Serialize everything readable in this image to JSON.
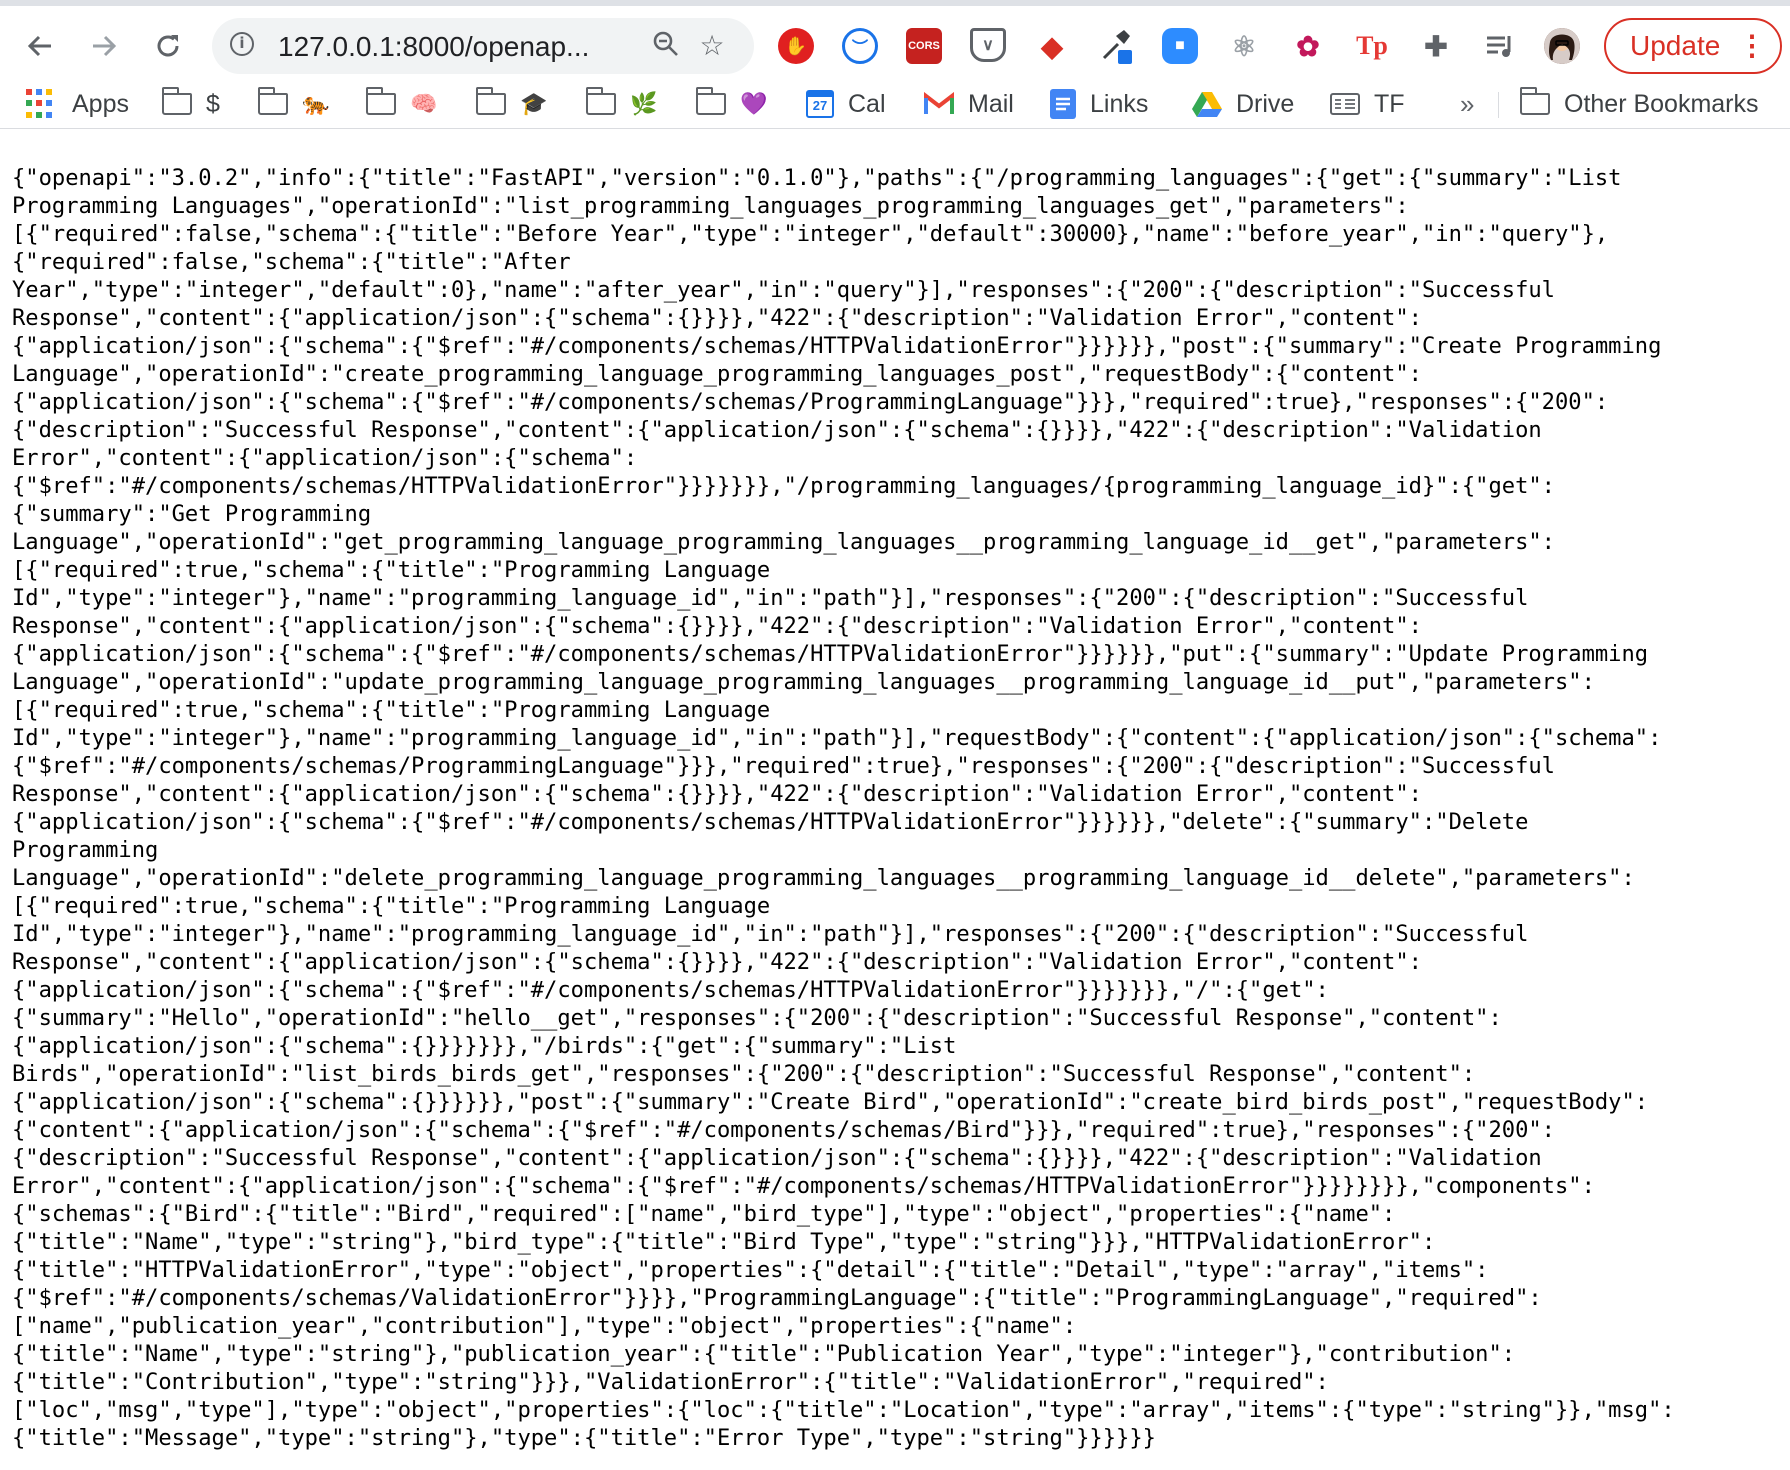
{
  "browser": {
    "url": "127.0.0.1:8000/openap...",
    "update_label": "Update",
    "menu_icon": "⋮"
  },
  "bookmarks": {
    "apps": "Apps",
    "folder1": "$",
    "folder2": "🐅",
    "folder3": "🧠",
    "folder4": "🎓",
    "folder5": "🌿",
    "folder6": "💜",
    "cal": "Cal",
    "cal_day": "27",
    "mail": "Mail",
    "links": "Links",
    "drive": "Drive",
    "tf": "TF",
    "more": "»",
    "other": "Other Bookmarks"
  },
  "colors": {
    "update": "#d93025",
    "brand_blue": "#1a73e8"
  },
  "json_lines": [
    "{\"openapi\":\"3.0.2\",\"info\":{\"title\":\"FastAPI\",\"version\":\"0.1.0\"},\"paths\":{\"/programming_languages\":{\"get\":{\"summary\":\"List",
    "Programming Languages\",\"operationId\":\"list_programming_languages_programming_languages_get\",\"parameters\":",
    "[{\"required\":false,\"schema\":{\"title\":\"Before Year\",\"type\":\"integer\",\"default\":30000},\"name\":\"before_year\",\"in\":\"query\"},",
    "{\"required\":false,\"schema\":{\"title\":\"After",
    "Year\",\"type\":\"integer\",\"default\":0},\"name\":\"after_year\",\"in\":\"query\"}],\"responses\":{\"200\":{\"description\":\"Successful",
    "Response\",\"content\":{\"application/json\":{\"schema\":{}}}},\"422\":{\"description\":\"Validation Error\",\"content\":",
    "{\"application/json\":{\"schema\":{\"$ref\":\"#/components/schemas/HTTPValidationError\"}}}}}},\"post\":{\"summary\":\"Create Programming",
    "Language\",\"operationId\":\"create_programming_language_programming_languages_post\",\"requestBody\":{\"content\":",
    "{\"application/json\":{\"schema\":{\"$ref\":\"#/components/schemas/ProgrammingLanguage\"}}},\"required\":true},\"responses\":{\"200\":",
    "{\"description\":\"Successful Response\",\"content\":{\"application/json\":{\"schema\":{}}}},\"422\":{\"description\":\"Validation",
    "Error\",\"content\":{\"application/json\":{\"schema\":",
    "{\"$ref\":\"#/components/schemas/HTTPValidationError\"}}}}}}},\"/programming_languages/{programming_language_id}\":{\"get\":",
    "{\"summary\":\"Get Programming",
    "Language\",\"operationId\":\"get_programming_language_programming_languages__programming_language_id__get\",\"parameters\":",
    "[{\"required\":true,\"schema\":{\"title\":\"Programming Language",
    "Id\",\"type\":\"integer\"},\"name\":\"programming_language_id\",\"in\":\"path\"}],\"responses\":{\"200\":{\"description\":\"Successful",
    "Response\",\"content\":{\"application/json\":{\"schema\":{}}}},\"422\":{\"description\":\"Validation Error\",\"content\":",
    "{\"application/json\":{\"schema\":{\"$ref\":\"#/components/schemas/HTTPValidationError\"}}}}}},\"put\":{\"summary\":\"Update Programming",
    "Language\",\"operationId\":\"update_programming_language_programming_languages__programming_language_id__put\",\"parameters\":",
    "[{\"required\":true,\"schema\":{\"title\":\"Programming Language",
    "Id\",\"type\":\"integer\"},\"name\":\"programming_language_id\",\"in\":\"path\"}],\"requestBody\":{\"content\":{\"application/json\":{\"schema\":",
    "{\"$ref\":\"#/components/schemas/ProgrammingLanguage\"}}},\"required\":true},\"responses\":{\"200\":{\"description\":\"Successful",
    "Response\",\"content\":{\"application/json\":{\"schema\":{}}}},\"422\":{\"description\":\"Validation Error\",\"content\":",
    "{\"application/json\":{\"schema\":{\"$ref\":\"#/components/schemas/HTTPValidationError\"}}}}}},\"delete\":{\"summary\":\"Delete",
    "Programming",
    "Language\",\"operationId\":\"delete_programming_language_programming_languages__programming_language_id__delete\",\"parameters\":",
    "[{\"required\":true,\"schema\":{\"title\":\"Programming Language",
    "Id\",\"type\":\"integer\"},\"name\":\"programming_language_id\",\"in\":\"path\"}],\"responses\":{\"200\":{\"description\":\"Successful",
    "Response\",\"content\":{\"application/json\":{\"schema\":{}}}},\"422\":{\"description\":\"Validation Error\",\"content\":",
    "{\"application/json\":{\"schema\":{\"$ref\":\"#/components/schemas/HTTPValidationError\"}}}}}}},\"/\":{\"get\":",
    "{\"summary\":\"Hello\",\"operationId\":\"hello__get\",\"responses\":{\"200\":{\"description\":\"Successful Response\",\"content\":",
    "{\"application/json\":{\"schema\":{}}}}}}},\"/birds\":{\"get\":{\"summary\":\"List",
    "Birds\",\"operationId\":\"list_birds_birds_get\",\"responses\":{\"200\":{\"description\":\"Successful Response\",\"content\":",
    "{\"application/json\":{\"schema\":{}}}}}},\"post\":{\"summary\":\"Create Bird\",\"operationId\":\"create_bird_birds_post\",\"requestBody\":",
    "{\"content\":{\"application/json\":{\"schema\":{\"$ref\":\"#/components/schemas/Bird\"}}},\"required\":true},\"responses\":{\"200\":",
    "{\"description\":\"Successful Response\",\"content\":{\"application/json\":{\"schema\":{}}}},\"422\":{\"description\":\"Validation",
    "Error\",\"content\":{\"application/json\":{\"schema\":{\"$ref\":\"#/components/schemas/HTTPValidationError\"}}}}}}}},\"components\":",
    "{\"schemas\":{\"Bird\":{\"title\":\"Bird\",\"required\":[\"name\",\"bird_type\"],\"type\":\"object\",\"properties\":{\"name\":",
    "{\"title\":\"Name\",\"type\":\"string\"},\"bird_type\":{\"title\":\"Bird Type\",\"type\":\"string\"}}},\"HTTPValidationError\":",
    "{\"title\":\"HTTPValidationError\",\"type\":\"object\",\"properties\":{\"detail\":{\"title\":\"Detail\",\"type\":\"array\",\"items\":",
    "{\"$ref\":\"#/components/schemas/ValidationError\"}}}},\"ProgrammingLanguage\":{\"title\":\"ProgrammingLanguage\",\"required\":",
    "[\"name\",\"publication_year\",\"contribution\"],\"type\":\"object\",\"properties\":{\"name\":",
    "{\"title\":\"Name\",\"type\":\"string\"},\"publication_year\":{\"title\":\"Publication Year\",\"type\":\"integer\"},\"contribution\":",
    "{\"title\":\"Contribution\",\"type\":\"string\"}}},\"ValidationError\":{\"title\":\"ValidationError\",\"required\":",
    "[\"loc\",\"msg\",\"type\"],\"type\":\"object\",\"properties\":{\"loc\":{\"title\":\"Location\",\"type\":\"array\",\"items\":{\"type\":\"string\"}},\"msg\":",
    "{\"title\":\"Message\",\"type\":\"string\"},\"type\":{\"title\":\"Error Type\",\"type\":\"string\"}}}}}}"
  ]
}
